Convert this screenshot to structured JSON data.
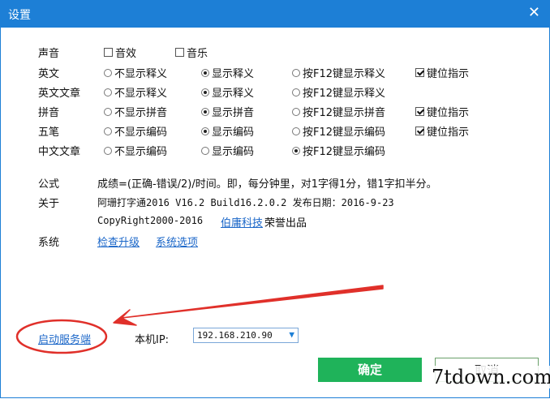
{
  "window": {
    "title": "设置"
  },
  "sound": {
    "label": "声音",
    "effects": "音效",
    "music": "音乐"
  },
  "english": {
    "label": "英文",
    "opt1": "不显示释义",
    "opt2": "显示释义",
    "opt3": "按F12键显示释义",
    "key_hint": "键位指示"
  },
  "english_article": {
    "label": "英文文章",
    "opt1": "不显示释义",
    "opt2": "显示释义",
    "opt3": "按F12键显示释义"
  },
  "pinyin": {
    "label": "拼音",
    "opt1": "不显示拼音",
    "opt2": "显示拼音",
    "opt3": "按F12键显示拼音",
    "key_hint": "键位指示"
  },
  "wubi": {
    "label": "五笔",
    "opt1": "不显示编码",
    "opt2": "显示编码",
    "opt3": "按F12键显示编码",
    "key_hint": "键位指示"
  },
  "chinese_article": {
    "label": "中文文章",
    "opt1": "不显示编码",
    "opt2": "显示编码",
    "opt3": "按F12键显示编码"
  },
  "formula": {
    "label": "公式",
    "text": "成绩=(正确-错误/2)/时间。即，每分钟里，对1字得1分，错1字扣半分。"
  },
  "about": {
    "label": "关于",
    "line1": "阿珊打字通2016 V16.2 Build16.2.0.2 发布日期：2016-9-23",
    "copyright": "CopyRight2000-2016",
    "company": "伯庸科技",
    "suffix": "荣誉出品"
  },
  "system": {
    "label": "系统",
    "check_update": "检查升级",
    "options": "系统选项"
  },
  "server": {
    "start_link": "启动服务端",
    "ip_label": "本机IP:",
    "ip_value": "192.168.210.90"
  },
  "buttons": {
    "ok": "确定",
    "cancel": "取消"
  },
  "watermark": "7tdown.com",
  "colors": {
    "titlebar": "#1d7fd6",
    "ok": "#1fb35a",
    "annotation": "#e0302a",
    "link": "#1a66c8"
  }
}
